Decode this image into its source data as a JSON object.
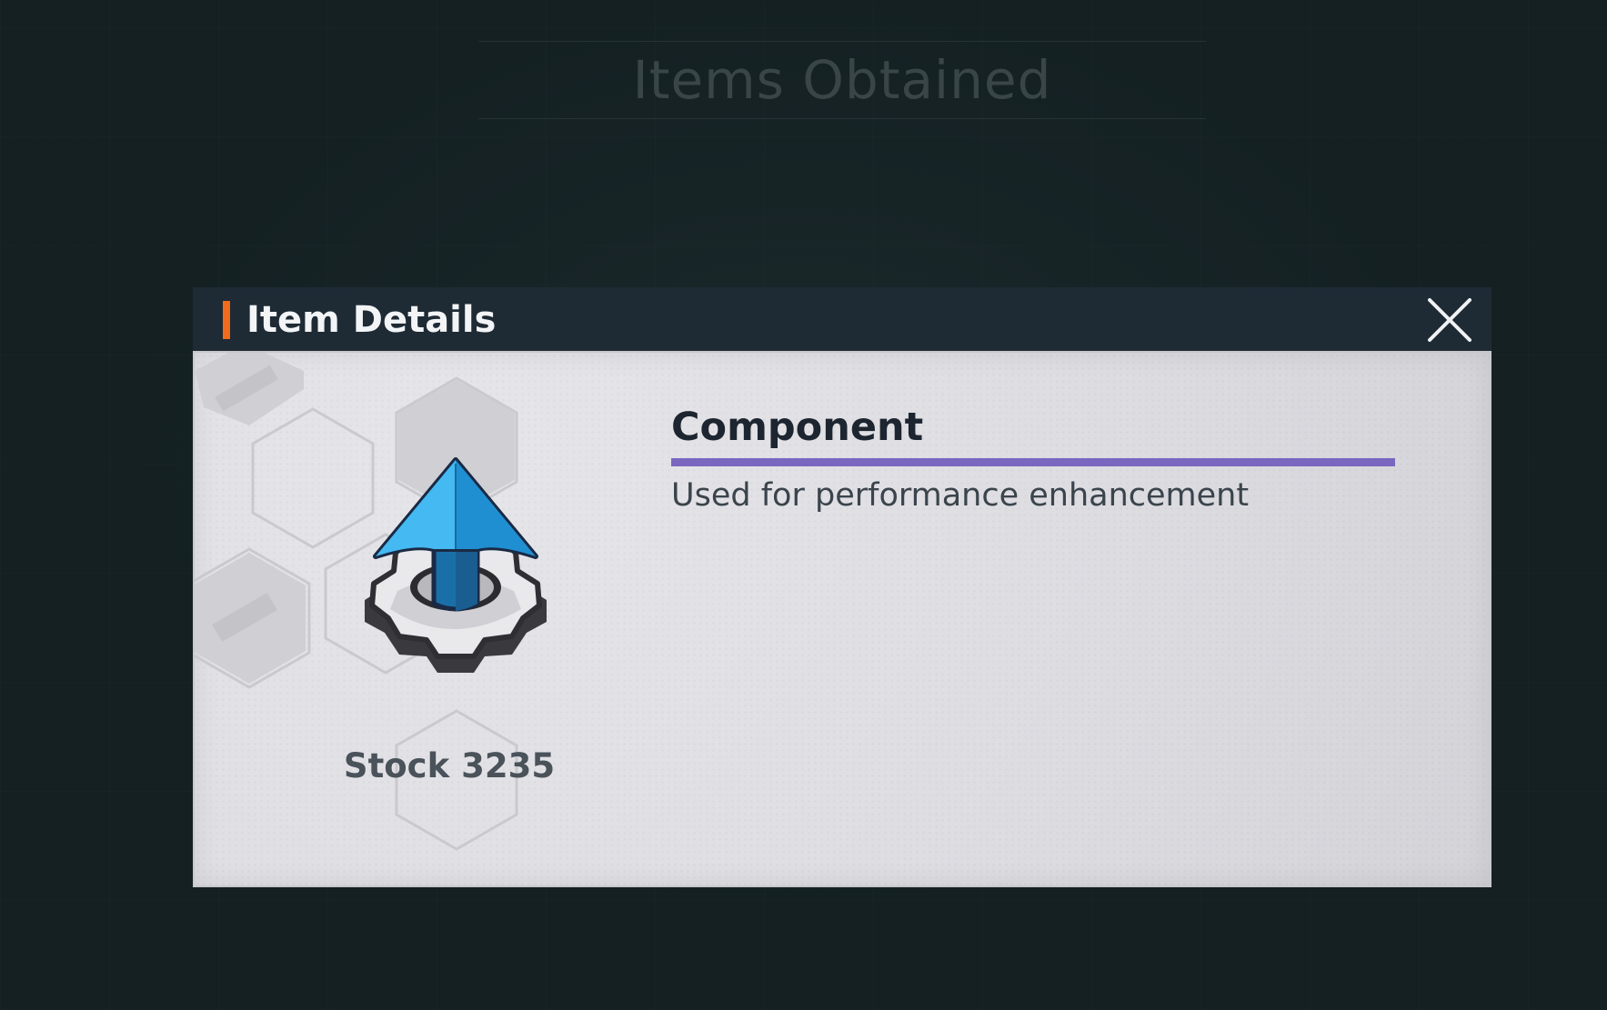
{
  "background": {
    "title": "Items Obtained"
  },
  "dialog": {
    "header_title": "Item Details",
    "close_icon": "close-icon",
    "accent_color": "#f26a1b",
    "item": {
      "icon": "gear-upgrade-arrow-icon",
      "name": "Component",
      "rarity_color": "#7a67c0",
      "description": "Used for performance enhancement",
      "stock_text": "Stock 3235"
    }
  }
}
